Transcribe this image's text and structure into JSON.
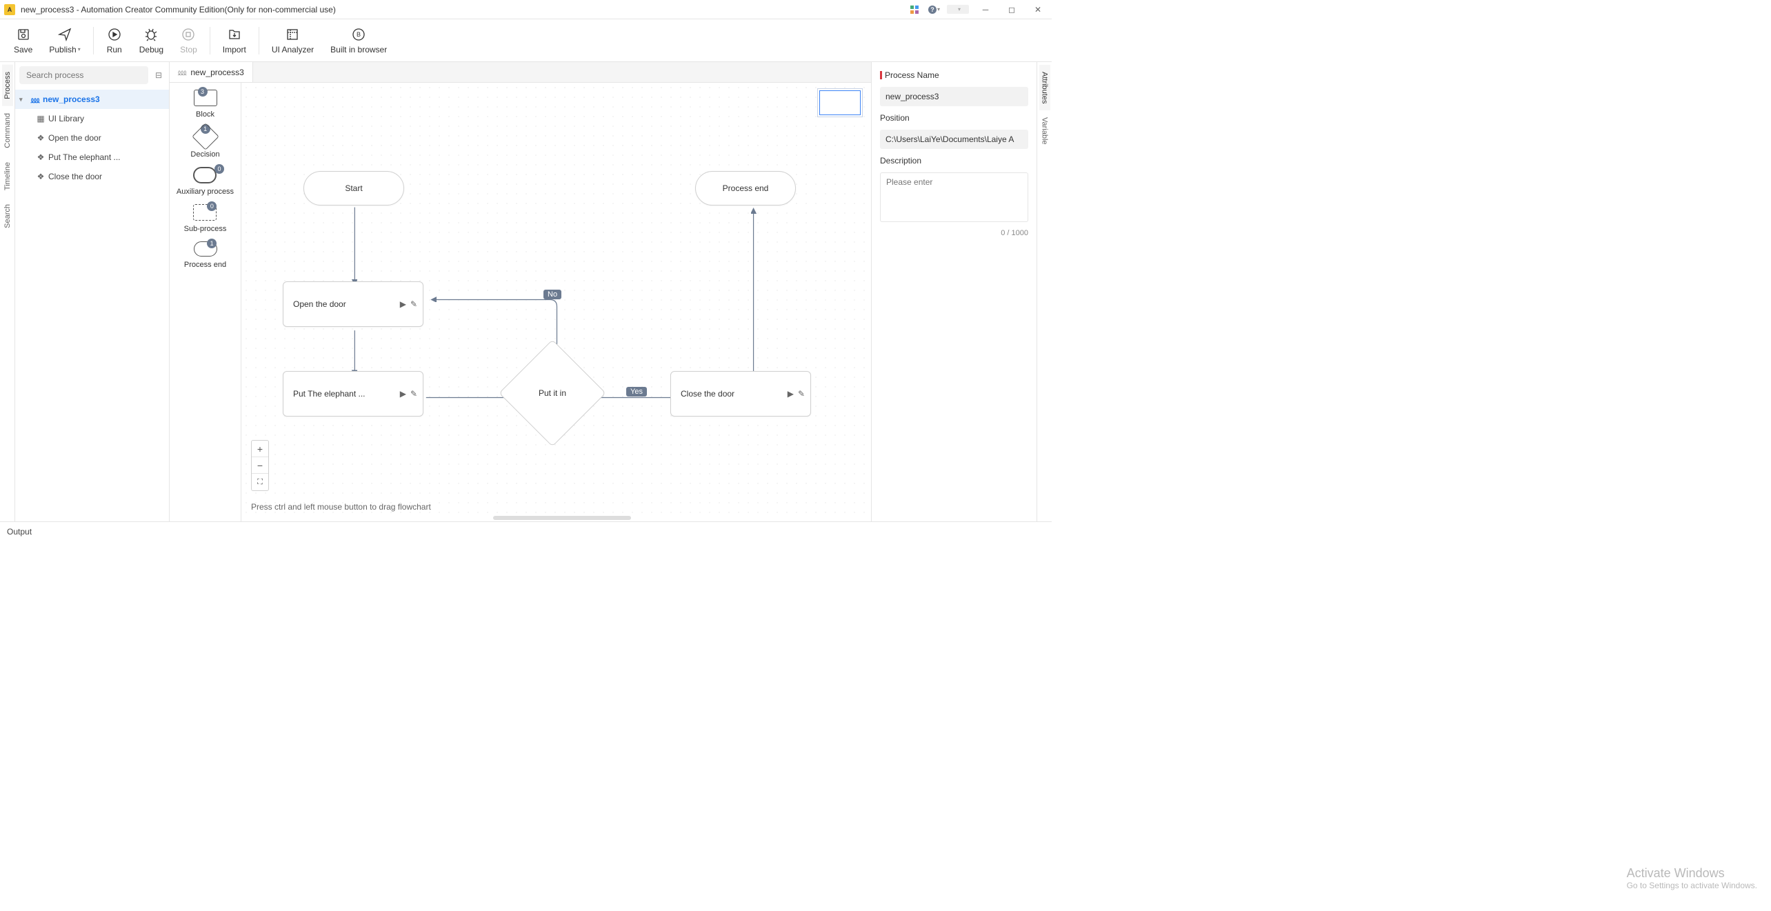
{
  "titlebar": {
    "title": "new_process3 - Automation Creator Community Edition(Only for non-commercial use)",
    "user": " "
  },
  "toolbar": {
    "save": "Save",
    "publish": "Publish",
    "run": "Run",
    "debug": "Debug",
    "stop": "Stop",
    "import": "Import",
    "ui_analyzer": "UI Analyzer",
    "built_in_browser": "Built in browser"
  },
  "vtabs": {
    "process": "Process",
    "command": "Command",
    "timeline": "Timeline",
    "search": "Search"
  },
  "vtabs_right": {
    "attributes": "Attributes",
    "variable": "Variable"
  },
  "tree": {
    "search_placeholder": "Search process",
    "root": "new_process3",
    "items": [
      "UI Library",
      "Open the door",
      "Put The elephant ...",
      "Close the door"
    ]
  },
  "tab": {
    "label": "new_process3"
  },
  "palette": {
    "block": {
      "label": "Block",
      "badge": "3"
    },
    "decision": {
      "label": "Decision",
      "badge": "1"
    },
    "aux": {
      "label": "Auxiliary process",
      "badge": "0"
    },
    "sub": {
      "label": "Sub-process",
      "badge": "0"
    },
    "end": {
      "label": "Process end",
      "badge": "1"
    }
  },
  "nodes": {
    "start": "Start",
    "open": "Open the door",
    "put": "Put The elephant ...",
    "decision": "Put it in",
    "close": "Close the door",
    "end": "Process end",
    "yes": "Yes",
    "no": "No"
  },
  "hint": "Press ctrl and left mouse button to drag flowchart",
  "props": {
    "name_label": "Process Name",
    "name_value": "new_process3",
    "position_label": "Position",
    "position_value": "C:\\Users\\LaiYe\\Documents\\Laiye A",
    "desc_label": "Description",
    "desc_placeholder": "Please enter",
    "char_count": "0 / 1000"
  },
  "watermark": {
    "l1": "Activate Windows",
    "l2": "Go to Settings to activate Windows."
  },
  "statusbar": {
    "output": "Output"
  }
}
